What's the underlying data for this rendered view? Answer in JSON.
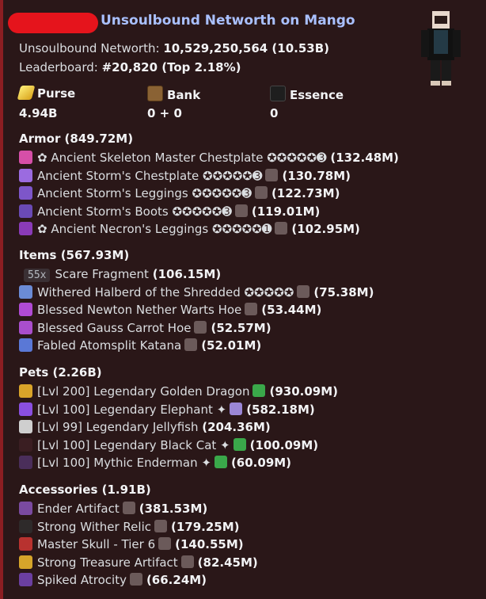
{
  "header": {
    "title": "Unsoulbound Networth on Mango"
  },
  "summary": {
    "networth_label": "Unsoulbound Networth: ",
    "networth_value": "10,529,250,564 (10.53B)",
    "leaderboard_label": "Leaderboard: ",
    "leaderboard_value": "#20,820 (Top 2.18%)"
  },
  "fields": [
    {
      "name": "Purse",
      "value": "4.94B",
      "icon": "gold-ingot-icon"
    },
    {
      "name": "Bank",
      "value": "0 + 0",
      "icon": "chest-icon"
    },
    {
      "name": "Essence",
      "value": "0",
      "icon": "essence-icon"
    }
  ],
  "sections": [
    {
      "title": "Armor (849.72M)",
      "items": [
        {
          "text": "✿ Ancient Skeleton Master Chestplate ✪✪✪✪✪➌",
          "tail": false,
          "value": "(132.48M)",
          "icon_color": "#d64fa8"
        },
        {
          "text": "Ancient Storm's Chestplate ✪✪✪✪✪➌",
          "tail": true,
          "value": "(130.78M)",
          "icon_color": "#9b6be0"
        },
        {
          "text": "Ancient Storm's Leggings ✪✪✪✪✪➌",
          "tail": true,
          "value": "(122.73M)",
          "icon_color": "#7d56c9"
        },
        {
          "text": "Ancient Storm's Boots ✪✪✪✪✪➌",
          "tail": true,
          "value": "(119.01M)",
          "icon_color": "#6a4ab5"
        },
        {
          "text": "✿ Ancient Necron's Leggings ✪✪✪✪✪➊",
          "tail": true,
          "value": "(102.95M)",
          "icon_color": "#8a3bb8"
        }
      ]
    },
    {
      "title": "Items (567.93M)",
      "items": [
        {
          "badge": "55x",
          "text": "Scare Fragment",
          "tail": false,
          "value": "(106.15M)",
          "icon_color": ""
        },
        {
          "text": "Withered Halberd of the Shredded ✪✪✪✪✪",
          "tail": true,
          "value": "(75.38M)",
          "icon_color": "#6b8bd6"
        },
        {
          "text": "Blessed Newton Nether Warts Hoe",
          "tail": true,
          "value": "(53.44M)",
          "icon_color": "#b04bd4"
        },
        {
          "text": "Blessed Gauss Carrot Hoe",
          "tail": true,
          "value": "(52.57M)",
          "icon_color": "#a94ecc"
        },
        {
          "text": "Fabled Atomsplit Katana",
          "tail": true,
          "value": "(52.01M)",
          "icon_color": "#5a78d6"
        }
      ]
    },
    {
      "title": "Pets (2.26B)",
      "items": [
        {
          "text": "[Lvl 200] Legendary Golden Dragon",
          "tail": true,
          "value": "(930.09M)",
          "icon_color": "#d9a429",
          "tail_color": "#3aa84a"
        },
        {
          "text": "[Lvl 100] Legendary Elephant ✦",
          "tail": true,
          "value": "(582.18M)",
          "icon_color": "#8a4fe0",
          "tail_color": "#9b87d6"
        },
        {
          "text": "[Lvl 99] Legendary Jellyfish",
          "tail": false,
          "value": "(204.36M)",
          "icon_color": "#cfcfcf"
        },
        {
          "text": "[Lvl 100] Legendary Black Cat ✦",
          "tail": true,
          "value": "(100.09M)",
          "icon_color": "#3a1e22",
          "tail_color": "#3aa84a"
        },
        {
          "text": "[Lvl 100] Mythic Enderman ✦",
          "tail": true,
          "value": "(60.09M)",
          "icon_color": "#4a2e5a",
          "tail_color": "#3aa84a"
        }
      ]
    },
    {
      "title": "Accessories (1.91B)",
      "items": [
        {
          "text": "Ender Artifact",
          "tail": true,
          "value": "(381.53M)",
          "icon_color": "#7a4aa0"
        },
        {
          "text": "Strong Wither Relic",
          "tail": true,
          "value": "(179.25M)",
          "icon_color": "#2e2a2a"
        },
        {
          "text": "Master Skull - Tier 6",
          "tail": true,
          "value": "(140.55M)",
          "icon_color": "#b8322f"
        },
        {
          "text": "Strong Treasure Artifact",
          "tail": true,
          "value": "(82.45M)",
          "icon_color": "#d6a52a"
        },
        {
          "text": "Spiked Atrocity",
          "tail": true,
          "value": "(66.24M)",
          "icon_color": "#6b3fa0"
        }
      ]
    }
  ]
}
